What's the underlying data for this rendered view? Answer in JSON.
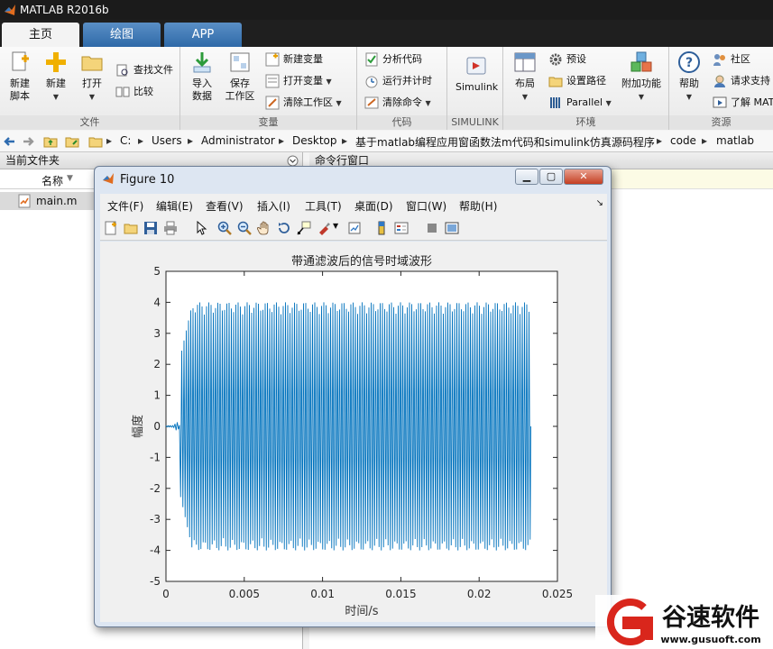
{
  "window": {
    "title": "MATLAB R2016b"
  },
  "tabs": [
    {
      "label": "主页",
      "active": true
    },
    {
      "label": "绘图",
      "active": false
    },
    {
      "label": "APP",
      "active": false
    }
  ],
  "ribbon": {
    "file": {
      "group_label": "文件",
      "new_script": "新建\n脚本",
      "new": "新建",
      "open": "打开",
      "find_files": "查找文件",
      "compare": "比较"
    },
    "variable": {
      "group_label": "变量",
      "import": "导入\n数据",
      "save_ws": "保存\n工作区",
      "new_var": "新建变量",
      "open_var": "打开变量",
      "clear_ws": "清除工作区"
    },
    "code": {
      "group_label": "代码",
      "analyze": "分析代码",
      "run_time": "运行并计时",
      "clear_cmd": "清除命令"
    },
    "simulink": {
      "group_label": "SIMULINK",
      "simulink": "Simulink"
    },
    "environment": {
      "group_label": "环境",
      "layout": "布局",
      "prefs": "预设",
      "set_path": "设置路径",
      "parallel": "Parallel",
      "addons": "附加功能"
    },
    "resources": {
      "group_label": "资源",
      "help": "帮助",
      "community": "社区",
      "request_support": "请求支持",
      "learn_matlab": "了解 MAT"
    }
  },
  "address": {
    "parts": [
      "C:",
      "Users",
      "Administrator",
      "Desktop",
      "基于matlab编程应用窗函数法m代码和simulink仿真源码程序",
      "code",
      "matlab"
    ]
  },
  "current_folder": {
    "title": "当前文件夹",
    "col_name": "名称",
    "sort_indicator": "▼",
    "files": [
      "main.m"
    ]
  },
  "command_window": {
    "title": "命令行窗口"
  },
  "figure": {
    "title": "Figure 10",
    "menu": [
      "文件(F)",
      "编辑(E)",
      "查看(V)",
      "插入(I)",
      "工具(T)",
      "桌面(D)",
      "窗口(W)",
      "帮助(H)"
    ]
  },
  "chart_data": {
    "type": "line",
    "title": "带通滤波后的信号时域波形",
    "xlabel": "时间/s",
    "ylabel": "幅度",
    "xlim": [
      0,
      0.025
    ],
    "ylim": [
      -5,
      5
    ],
    "xticks": [
      "0",
      "0.005",
      "0.01",
      "0.015",
      "0.02",
      "0.025"
    ],
    "yticks": [
      "5",
      "4",
      "3",
      "2",
      "1",
      "0",
      "-1",
      "-2",
      "-3",
      "-4",
      "-5"
    ],
    "series": [
      {
        "signal_start": 0.0,
        "onset": 0.0009,
        "steady_from": 0.0017,
        "end": 0.0233,
        "amplitude": 4.0,
        "color": "#0072bd"
      }
    ]
  },
  "watermark": {
    "text": "谷速软件",
    "url": "www.gusuoft.com",
    "accent": "#d9261c"
  }
}
